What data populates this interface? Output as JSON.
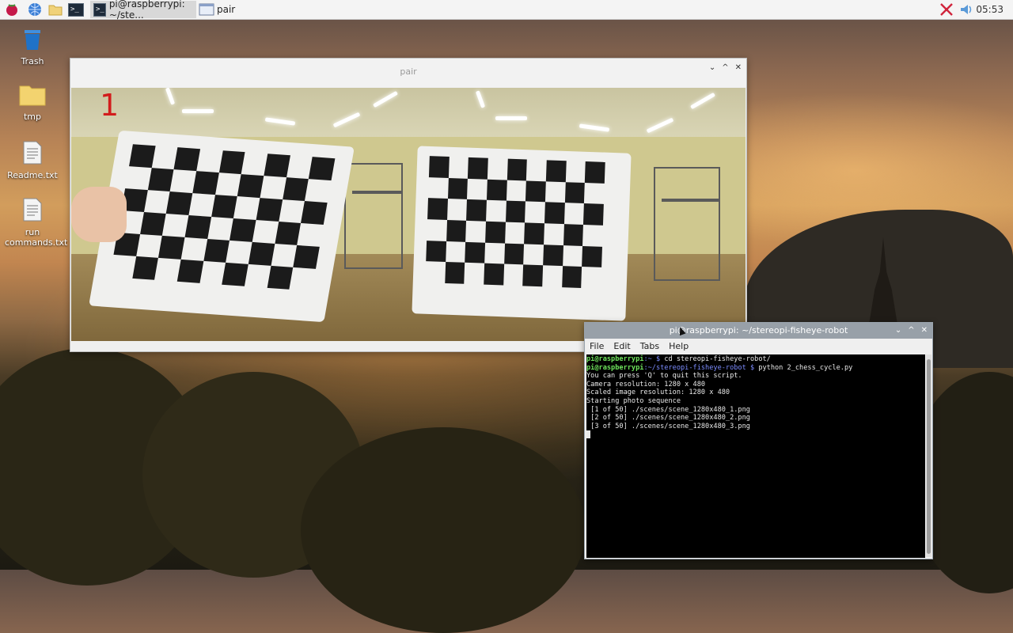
{
  "taskbar": {
    "tasks": [
      {
        "label": "pi@raspberrypi: ~/ste..."
      },
      {
        "label": "pair"
      }
    ],
    "clock": "05:53"
  },
  "desktop": {
    "icons": [
      {
        "label": "Trash",
        "icon": "trash-icon"
      },
      {
        "label": "tmp",
        "icon": "folder-icon"
      },
      {
        "label": "Readme.txt",
        "icon": "text-file-icon"
      },
      {
        "label": "run commands.txt",
        "icon": "text-file-icon"
      }
    ]
  },
  "pair_window": {
    "title": "pair",
    "counter": "1",
    "buttons": [
      "⌄",
      "^",
      "✕"
    ]
  },
  "terminal": {
    "title": "pi@raspberrypi: ~/stereopi-fisheye-robot",
    "menu": [
      "File",
      "Edit",
      "Tabs",
      "Help"
    ],
    "line1": {
      "user": "pi@raspberrypi",
      "path": ":~ $",
      "cmd": " cd stereopi-fisheye-robot/"
    },
    "line2": {
      "user": "pi@raspberrypi",
      "path": ":~/stereopi-fisheye-robot $",
      "cmd": " python 2_chess_cycle.py"
    },
    "output": [
      "You can press 'Q' to quit this script.",
      "Camera resolution: 1280 x 480",
      "Scaled image resolution: 1280 x 480",
      "Starting photo sequence",
      " [1 of 50] ./scenes/scene_1280x480_1.png",
      " [2 of 50] ./scenes/scene_1280x480_2.png",
      " [3 of 50] ./scenes/scene_1280x480_3.png"
    ]
  },
  "colors": {
    "prompt_user": "#6ee35c",
    "prompt_path": "#7c8cff",
    "countdown": "#d21c1c"
  }
}
